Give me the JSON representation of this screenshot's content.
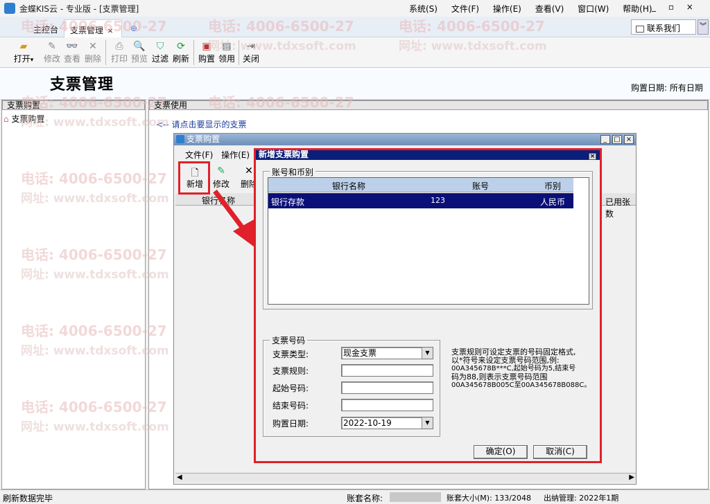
{
  "app": {
    "title": "金蝶KIS云 - 专业版 - [支票管理]",
    "menus": [
      "系统(S)",
      "文件(F)",
      "操作(E)",
      "查看(V)",
      "窗口(W)",
      "帮助(H)"
    ],
    "window_controls": [
      "_",
      "▫",
      "×"
    ]
  },
  "tabs": {
    "home": "主控台",
    "active": "支票管理",
    "close": "✕",
    "add": "⊕"
  },
  "contact_button": "联系我们",
  "toolbar": {
    "open": "打开",
    "open_arrow": "▾",
    "modify": "修改",
    "view": "查看",
    "delete": "删除",
    "print": "打印",
    "preview": "预览",
    "filter": "过滤",
    "refresh": "刷新",
    "purchase": "购置",
    "receive": "领用",
    "close": "关闭"
  },
  "page": {
    "title": "支票管理",
    "purchase_date_label": "购置日期:",
    "purchase_date_value": "所有日期"
  },
  "left_panel": {
    "header": "支票购置",
    "tree_item": "支票购置"
  },
  "right_panel": {
    "header": "支票使用",
    "hint": "<-- 请点击要显示的支票"
  },
  "watermark": {
    "phone": "电话: 4006-6500-27",
    "site": "网址: www.tdxsoft.com"
  },
  "purchase_window": {
    "title": "支票购置",
    "menu_file": "文件(F)",
    "menu_edit": "操作(E)",
    "btn_new": "新增",
    "btn_modify": "修改",
    "btn_delete": "删除",
    "col_bank": "银行名称",
    "col_used": "已用张数"
  },
  "dialog": {
    "title": "新增支票购置",
    "group_account": "账号和币别",
    "columns": {
      "bank": "银行名称",
      "account": "账号",
      "currency": "币别"
    },
    "rows": [
      {
        "bank": "银行存款",
        "account": "123",
        "currency": "人民币"
      }
    ],
    "group_cheque": "支票号码",
    "type_label": "支票类型:",
    "type_value": "现金支票",
    "rule_label": "支票规则:",
    "rule_value": "",
    "start_label": "起始号码:",
    "start_value": "",
    "end_label": "结束号码:",
    "end_value": "",
    "date_label": "购置日期:",
    "date_value": "2022-10-19",
    "help_line1": "支票规则可设定支票的号码固定格式,",
    "help_line2": "以*符号来设定支票号码范围,例:",
    "help_line3": "00A345678B***C,起始号码为5,结束号",
    "help_line4": "码为88,则表示支票号码范围",
    "help_line5": "00A345678B005C至00A345678B088C。",
    "ok": "确定(O)",
    "cancel": "取消(C)"
  },
  "status": {
    "message": "刷新数据完毕",
    "account_label": "账套名称:",
    "size_label": "账套大小(M): 133/2048",
    "period": "出纳管理: 2022年1期"
  },
  "colors": {
    "highlight_red": "#e0202a",
    "selection_navy": "#0a1078",
    "dialog_title": "#0a1f7a"
  }
}
